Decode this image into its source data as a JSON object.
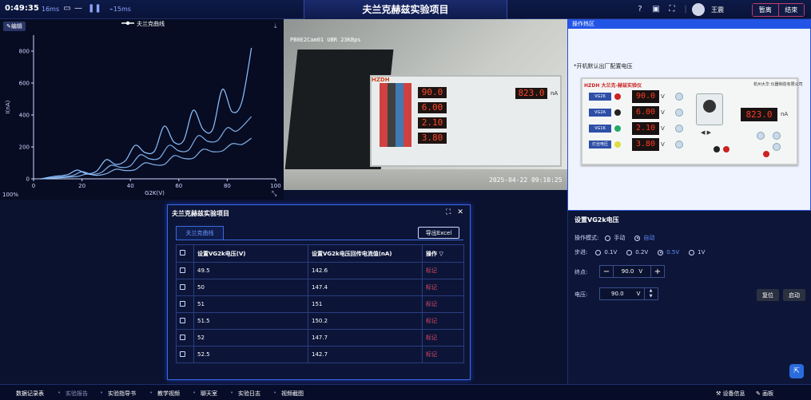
{
  "topbar": {
    "timer": "0:49:35",
    "stat1": "16ms",
    "stat2": "15ms",
    "title": "夫兰克赫兹实验项目",
    "username": "王震",
    "btn_leave": "暂离",
    "btn_end": "结束"
  },
  "chart_panel": {
    "edit_label": "✎编辑",
    "zoom": "100%"
  },
  "chart_data": {
    "type": "line",
    "legend": [
      "夫兰克曲线"
    ],
    "xlabel": "G2K(V)",
    "ylabel": "I(nA)",
    "xlim": [
      0,
      100
    ],
    "ylim": [
      0,
      900
    ],
    "xticks": [
      0,
      20,
      40,
      60,
      80,
      100
    ],
    "yticks": [
      0,
      200,
      400,
      600,
      800
    ],
    "series": [
      {
        "name": "夫兰克曲线",
        "points": [
          [
            3,
            0
          ],
          [
            8,
            14
          ],
          [
            14,
            26
          ],
          [
            18,
            55
          ],
          [
            22,
            32
          ],
          [
            26,
            48
          ],
          [
            30,
            120
          ],
          [
            34,
            90
          ],
          [
            38,
            115
          ],
          [
            42,
            210
          ],
          [
            46,
            165
          ],
          [
            50,
            175
          ],
          [
            54,
            330
          ],
          [
            58,
            230
          ],
          [
            62,
            240
          ],
          [
            66,
            430
          ],
          [
            70,
            310
          ],
          [
            74,
            310
          ],
          [
            78,
            560
          ],
          [
            82,
            420
          ],
          [
            86,
            480
          ],
          [
            90,
            820
          ]
        ]
      },
      {
        "name": "",
        "points": [
          [
            3,
            0
          ],
          [
            10,
            10
          ],
          [
            16,
            20
          ],
          [
            20,
            45
          ],
          [
            24,
            28
          ],
          [
            28,
            40
          ],
          [
            32,
            85
          ],
          [
            36,
            72
          ],
          [
            40,
            82
          ],
          [
            44,
            150
          ],
          [
            48,
            125
          ],
          [
            52,
            130
          ],
          [
            56,
            210
          ],
          [
            60,
            175
          ],
          [
            64,
            180
          ],
          [
            68,
            270
          ],
          [
            72,
            235
          ],
          [
            76,
            240
          ],
          [
            80,
            320
          ],
          [
            84,
            300
          ],
          [
            90,
            390
          ]
        ]
      },
      {
        "name": "",
        "points": [
          [
            3,
            0
          ],
          [
            12,
            8
          ],
          [
            18,
            15
          ],
          [
            22,
            30
          ],
          [
            26,
            22
          ],
          [
            30,
            32
          ],
          [
            34,
            60
          ],
          [
            38,
            52
          ],
          [
            42,
            58
          ],
          [
            46,
            100
          ],
          [
            50,
            88
          ],
          [
            54,
            90
          ],
          [
            58,
            145
          ],
          [
            62,
            128
          ],
          [
            66,
            130
          ],
          [
            70,
            185
          ],
          [
            74,
            170
          ],
          [
            78,
            175
          ],
          [
            82,
            220
          ],
          [
            86,
            215
          ],
          [
            90,
            255
          ]
        ]
      }
    ],
    "colors": {
      "series": "#8fc2ff",
      "axis": "#cfd8ff",
      "grid": "#1f2c57",
      "background": "#070c22"
    }
  },
  "video": {
    "osd": "PB0E2Cam01 UBR 23KBps",
    "timestamp": "2025-04-22    09:10:25",
    "device_logo": "HZDH",
    "readings": [
      "90.0",
      "6.00",
      "2.10",
      "3.80"
    ],
    "current": "823.0",
    "unit": "nA"
  },
  "hot_panel": {
    "title": "操作热区",
    "note": "*开机默认出厂配置电压",
    "logo": "HZDH 大兰克-赫兹实验仪",
    "maker": "杭州大华 仪器制造有限公司",
    "rows": [
      {
        "label": "VG2K",
        "value": "90.0",
        "unit": "V"
      },
      {
        "label": "VG2A",
        "value": "6.00",
        "unit": "V"
      },
      {
        "label": "VG1K",
        "value": "2.10",
        "unit": "V"
      },
      {
        "label": "灯丝电压",
        "value": "3.80",
        "unit": "V"
      }
    ],
    "current_value": "823.0",
    "current_unit": "nA"
  },
  "control": {
    "title": "设置VG2k电压",
    "mode_label": "操作模式:",
    "mode_options": [
      "手动",
      "自动"
    ],
    "mode_selected": "自动",
    "step_label": "步进:",
    "step_options": [
      "0.1V",
      "0.2V",
      "0.5V",
      "1V"
    ],
    "step_selected": "0.5V",
    "end_label": "终点:",
    "end_value": "90.0",
    "end_unit": "V",
    "volt_label": "电压:",
    "volt_value": "90.0",
    "volt_unit": "V",
    "reset_label": "复位",
    "start_label": "启动"
  },
  "dialog": {
    "title": "夫兰克赫兹实验项目",
    "tab": "夫兰克曲线",
    "export": "导出Excel",
    "columns": [
      "设置VG2k电压(V)",
      "设置VG2k电压回传电流值(nA)",
      "操作"
    ],
    "rows": [
      {
        "v": "49.5",
        "i": "142.6",
        "op": "标记"
      },
      {
        "v": "50",
        "i": "147.4",
        "op": "标记"
      },
      {
        "v": "51",
        "i": "151",
        "op": "标记"
      },
      {
        "v": "51.5",
        "i": "150.2",
        "op": "标记"
      },
      {
        "v": "52",
        "i": "147.7",
        "op": "标记"
      },
      {
        "v": "52.5",
        "i": "142.7",
        "op": "标记"
      }
    ]
  },
  "bottom_nav": {
    "items": [
      "数据记录表",
      "实验报告",
      "实验指导书",
      "教学视频",
      "聊天室",
      "实验日志",
      "视频截图"
    ],
    "right_items": [
      "设备信息",
      "画板"
    ]
  }
}
